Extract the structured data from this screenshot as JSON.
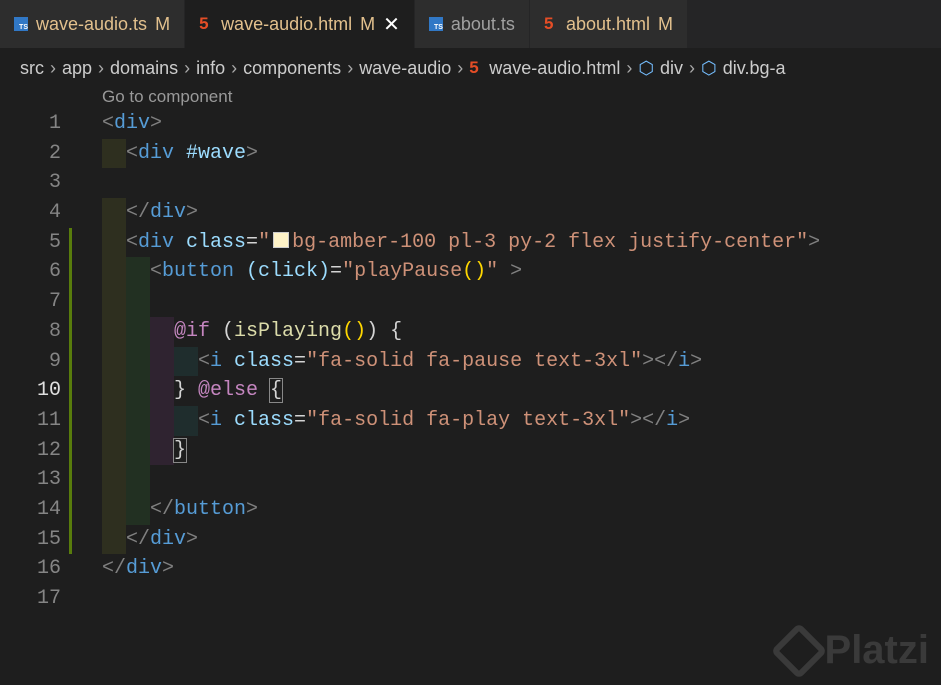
{
  "tabs": [
    {
      "label": "wave-audio.ts",
      "icon": "ts",
      "status": "M"
    },
    {
      "label": "wave-audio.html",
      "icon": "html",
      "status": "M",
      "active": true
    },
    {
      "label": "about.ts",
      "icon": "ts",
      "status": ""
    },
    {
      "label": "about.html",
      "icon": "html",
      "status": "M"
    }
  ],
  "icons": {
    "ts": "TS",
    "html": "5",
    "close": "✕"
  },
  "breadcrumb": [
    "src",
    "app",
    "domains",
    "info",
    "components",
    "wave-audio",
    "wave-audio.html",
    "div",
    "div.bg-a"
  ],
  "codelens": "Go to component",
  "current_line": 10,
  "lines": [
    {
      "n": 1,
      "ind": [],
      "t": [
        [
          "<",
          "tg"
        ],
        [
          "div",
          "tn"
        ],
        [
          ">",
          "tg"
        ]
      ]
    },
    {
      "n": 2,
      "ind": [
        0
      ],
      "t": [
        [
          "<",
          "tg"
        ],
        [
          "div",
          "tn"
        ],
        [
          " #wave",
          "at"
        ],
        [
          ">",
          "tg"
        ]
      ]
    },
    {
      "n": 3,
      "ind": [],
      "t": []
    },
    {
      "n": 4,
      "ind": [
        0
      ],
      "t": [
        [
          "</",
          "tg"
        ],
        [
          "div",
          "tn"
        ],
        [
          ">",
          "tg"
        ]
      ]
    },
    {
      "n": 5,
      "ind": [
        0
      ],
      "mod": true,
      "t": [
        [
          "<",
          "tg"
        ],
        [
          "div",
          "tn"
        ],
        [
          " class",
          "at"
        ],
        [
          "=",
          "pn"
        ],
        [
          "\"",
          "st"
        ],
        [
          "SWATCH",
          "sw"
        ],
        [
          "bg-amber-100 pl-3 py-2 flex justify-center\"",
          "st"
        ],
        [
          ">",
          "tg"
        ]
      ]
    },
    {
      "n": 6,
      "ind": [
        0,
        1
      ],
      "mod": true,
      "t": [
        [
          "<",
          "tg"
        ],
        [
          "button",
          "tn"
        ],
        [
          " (click)",
          "at"
        ],
        [
          "=",
          "pn"
        ],
        [
          "\"playPause",
          "st"
        ],
        [
          "()",
          "br"
        ],
        [
          "\"",
          "st"
        ],
        [
          " >",
          "tg"
        ]
      ]
    },
    {
      "n": 7,
      "ind": [
        0,
        1
      ],
      "mod": true,
      "t": []
    },
    {
      "n": 8,
      "ind": [
        0,
        1,
        2
      ],
      "mod": true,
      "t": [
        [
          "@if",
          "kw"
        ],
        [
          " (",
          "pn"
        ],
        [
          "isPlaying",
          "fn"
        ],
        [
          "()",
          "br"
        ],
        [
          ") {",
          "pn"
        ]
      ]
    },
    {
      "n": 9,
      "ind": [
        0,
        1,
        2,
        3
      ],
      "mod": true,
      "t": [
        [
          "<",
          "tg"
        ],
        [
          "i",
          "tn"
        ],
        [
          " class",
          "at"
        ],
        [
          "=",
          "pn"
        ],
        [
          "\"fa-solid fa-pause text-3xl\"",
          "st"
        ],
        [
          "></",
          "tg"
        ],
        [
          "i",
          "tn"
        ],
        [
          ">",
          "tg"
        ]
      ]
    },
    {
      "n": 10,
      "ind": [
        0,
        1,
        2
      ],
      "mod": true,
      "t": [
        [
          "} ",
          "pn"
        ],
        [
          "@else",
          "kw"
        ],
        [
          " ",
          "pn"
        ],
        [
          "{",
          "bx"
        ]
      ]
    },
    {
      "n": 11,
      "ind": [
        0,
        1,
        2,
        3
      ],
      "mod": true,
      "t": [
        [
          "<",
          "tg"
        ],
        [
          "i",
          "tn"
        ],
        [
          " class",
          "at"
        ],
        [
          "=",
          "pn"
        ],
        [
          "\"fa-solid fa-play text-3xl\"",
          "st"
        ],
        [
          "></",
          "tg"
        ],
        [
          "i",
          "tn"
        ],
        [
          ">",
          "tg"
        ]
      ]
    },
    {
      "n": 12,
      "ind": [
        0,
        1,
        2
      ],
      "mod": true,
      "t": [
        [
          "}",
          "bx"
        ]
      ]
    },
    {
      "n": 13,
      "ind": [
        0,
        1
      ],
      "mod": true,
      "t": []
    },
    {
      "n": 14,
      "ind": [
        0,
        1
      ],
      "mod": true,
      "t": [
        [
          "</",
          "tg"
        ],
        [
          "button",
          "tn"
        ],
        [
          ">",
          "tg"
        ]
      ]
    },
    {
      "n": 15,
      "ind": [
        0
      ],
      "mod": true,
      "t": [
        [
          "</",
          "tg"
        ],
        [
          "div",
          "tn"
        ],
        [
          ">",
          "tg"
        ]
      ]
    },
    {
      "n": 16,
      "ind": [],
      "t": [
        [
          "</",
          "tg"
        ],
        [
          "div",
          "tn"
        ],
        [
          ">",
          "tg"
        ]
      ]
    },
    {
      "n": 17,
      "ind": [],
      "t": []
    }
  ],
  "watermark": "Platzi"
}
